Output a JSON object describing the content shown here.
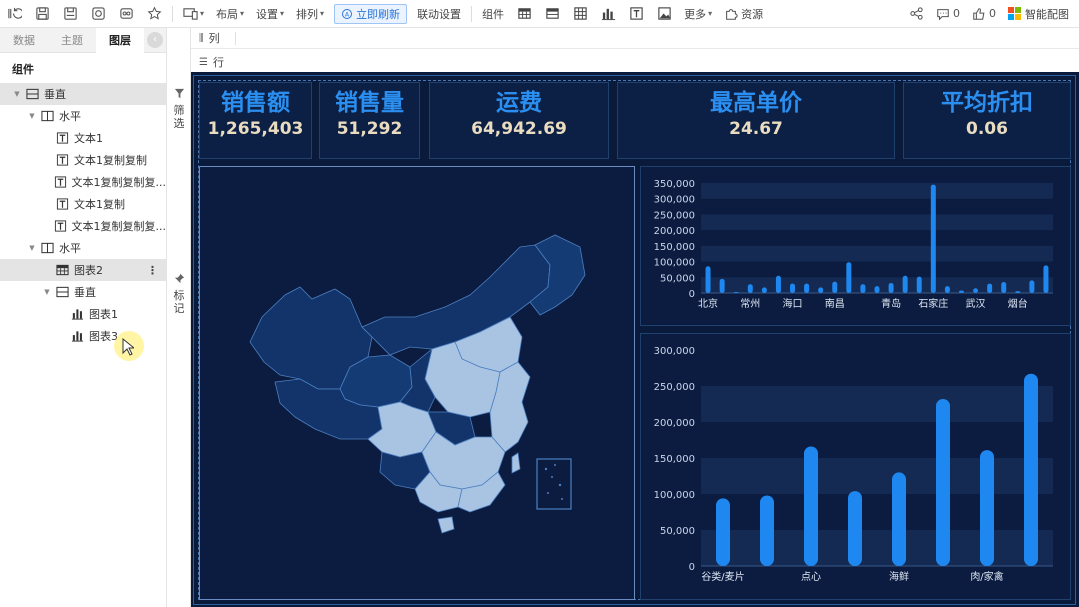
{
  "toolbar": {
    "left_icons": [
      "history-icon",
      "save-icon",
      "save-as-icon",
      "preview-icon",
      "share-preview-icon",
      "favorite-icon"
    ],
    "device_icon": "device-icon",
    "menus": [
      {
        "label": "布局"
      },
      {
        "label": "设置"
      },
      {
        "label": "排列"
      }
    ],
    "refresh_label": "立即刷新",
    "linkage_label": "联动设置",
    "component_label": "组件",
    "component_icons": [
      "table-icon",
      "crosstab-icon",
      "grid-icon",
      "bar-chart-icon",
      "text-icon",
      "image-icon"
    ],
    "more_label": "更多",
    "resource_label": "资源",
    "share_icon": "share-icon",
    "comment_count": "0",
    "like_count": "0",
    "smart_label": "智能配图"
  },
  "left_panel": {
    "tabs": [
      "数据",
      "主题",
      "图层"
    ],
    "active_tab": "图层",
    "section_title": "组件",
    "tree": [
      {
        "label": "垂直",
        "icon": "vertical-layout-icon",
        "indent": 0,
        "arrow": true,
        "selected": true
      },
      {
        "label": "水平",
        "icon": "horizontal-layout-icon",
        "indent": 1,
        "arrow": true
      },
      {
        "label": "文本1",
        "icon": "text-icon",
        "indent": 2
      },
      {
        "label": "文本1复制复制",
        "icon": "text-icon",
        "indent": 2
      },
      {
        "label": "文本1复制复制复...",
        "icon": "text-icon",
        "indent": 2
      },
      {
        "label": "文本1复制",
        "icon": "text-icon",
        "indent": 2
      },
      {
        "label": "文本1复制复制复...",
        "icon": "text-icon",
        "indent": 2
      },
      {
        "label": "水平",
        "icon": "horizontal-layout-icon",
        "indent": 1,
        "arrow": true
      },
      {
        "label": "图表2",
        "icon": "table-icon",
        "indent": 2,
        "selected": true,
        "more": true
      },
      {
        "label": "垂直",
        "icon": "vertical-layout-icon",
        "indent": 2,
        "arrow": true
      },
      {
        "label": "图表1",
        "icon": "bar-chart-icon",
        "indent": 3
      },
      {
        "label": "图表3",
        "icon": "bar-chart-icon",
        "indent": 3
      }
    ]
  },
  "side_strip": {
    "filter_label": "筛选",
    "mark_label": "标记"
  },
  "shelves": {
    "columns_label": "列",
    "rows_label": "行"
  },
  "dashboard": {
    "kpis": [
      {
        "title": "销售额",
        "value": "1,265,403"
      },
      {
        "title": "销售量",
        "value": "51,292"
      },
      {
        "title": "运费",
        "value": "64,942.69"
      },
      {
        "title": "最高单价",
        "value": "24.67"
      },
      {
        "title": "平均折扣",
        "value": "0.06"
      }
    ],
    "colors": {
      "background": "#0a1a3a",
      "kpi_title": "#2a8ff0",
      "kpi_value": "#e9dcc0",
      "bar": "#1e88f0",
      "map_dark": "#12346a",
      "map_light": "#a9c4e3"
    }
  },
  "chart_data": [
    {
      "type": "bar",
      "title": "",
      "xlabel": "",
      "ylabel": "",
      "ylim": [
        0,
        350000
      ],
      "yticks": [
        "0",
        "50,000",
        "100,000",
        "150,000",
        "200,000",
        "250,000",
        "300,000",
        "350,000"
      ],
      "tick_labels": [
        "北京",
        "常州",
        "海口",
        "南昌",
        "青岛",
        "石家庄",
        "武汉",
        "烟台"
      ],
      "values": [
        85000,
        45000,
        3000,
        28000,
        18000,
        55000,
        30000,
        30000,
        18000,
        36000,
        98000,
        28000,
        22000,
        32000,
        55000,
        52000,
        345000,
        22000,
        8000,
        15000,
        30000,
        35000,
        6000,
        40000,
        88000
      ]
    },
    {
      "type": "bar",
      "title": "",
      "xlabel": "",
      "ylabel": "",
      "ylim": [
        0,
        300000
      ],
      "yticks": [
        "0",
        "50,000",
        "100,000",
        "150,000",
        "200,000",
        "250,000",
        "300,000"
      ],
      "tick_labels": [
        "谷类/麦片",
        "点心",
        "海鲜",
        "肉/家禽"
      ],
      "values": [
        94000,
        98000,
        166000,
        104000,
        130000,
        232000,
        161000,
        267000
      ]
    }
  ]
}
